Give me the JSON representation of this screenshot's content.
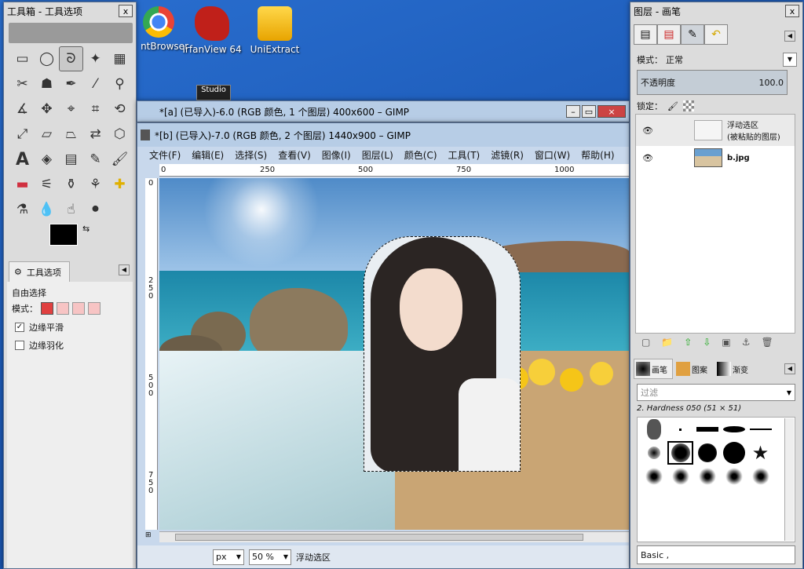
{
  "desktop": {
    "icons": [
      {
        "label": "ntBrowser"
      },
      {
        "label": "IrfanView 64"
      },
      {
        "label": "UniExtract"
      }
    ],
    "studio_label": "Studio"
  },
  "toolbox": {
    "title": "工具箱 - 工具选项",
    "close": "x",
    "tool_options_tab": "工具选项",
    "tool_name": "自由选择",
    "mode_label": "模式：",
    "antialias_label": "边缘平滑",
    "antialias_checked": true,
    "feather_label": "边缘羽化",
    "feather_checked": false
  },
  "window_a": {
    "title": "*[a] (已导入)-6.0 (RGB 颜色, 1 个图层) 400x600 – GIMP"
  },
  "window_b": {
    "title": "*[b] (已导入)-7.0 (RGB 颜色, 2 个图层) 1440x900 – GIMP",
    "menu": [
      "文件(F)",
      "编辑(E)",
      "选择(S)",
      "查看(V)",
      "图像(I)",
      "图层(L)",
      "颜色(C)",
      "工具(T)",
      "滤镜(R)",
      "窗口(W)",
      "帮助(H)"
    ],
    "ruler_h": [
      "0",
      "250",
      "500",
      "750",
      "1000"
    ],
    "ruler_v": [
      "0",
      "2\n5\n0",
      "5\n0\n0",
      "7\n5\n0"
    ],
    "unit": "px",
    "zoom": "50 %",
    "status": "浮动选区"
  },
  "layers": {
    "title": "图层 - 画笔",
    "mode_label": "模式：",
    "mode_value": "正常",
    "opacity_label": "不透明度",
    "opacity_value": "100.0",
    "lock_label": "锁定：",
    "items": [
      {
        "name": "浮动选区\n(被粘贴的图层)"
      },
      {
        "name": "b.jpg"
      }
    ],
    "brush_tabs": [
      "画笔",
      "图案",
      "渐变"
    ],
    "filter_placeholder": "过滤",
    "brush_name": "2. Hardness 050 (51 × 51)",
    "preset": "Basic ,"
  },
  "colors": {
    "desktop": "#1c5ab7",
    "accent": "#3b7dd8"
  }
}
